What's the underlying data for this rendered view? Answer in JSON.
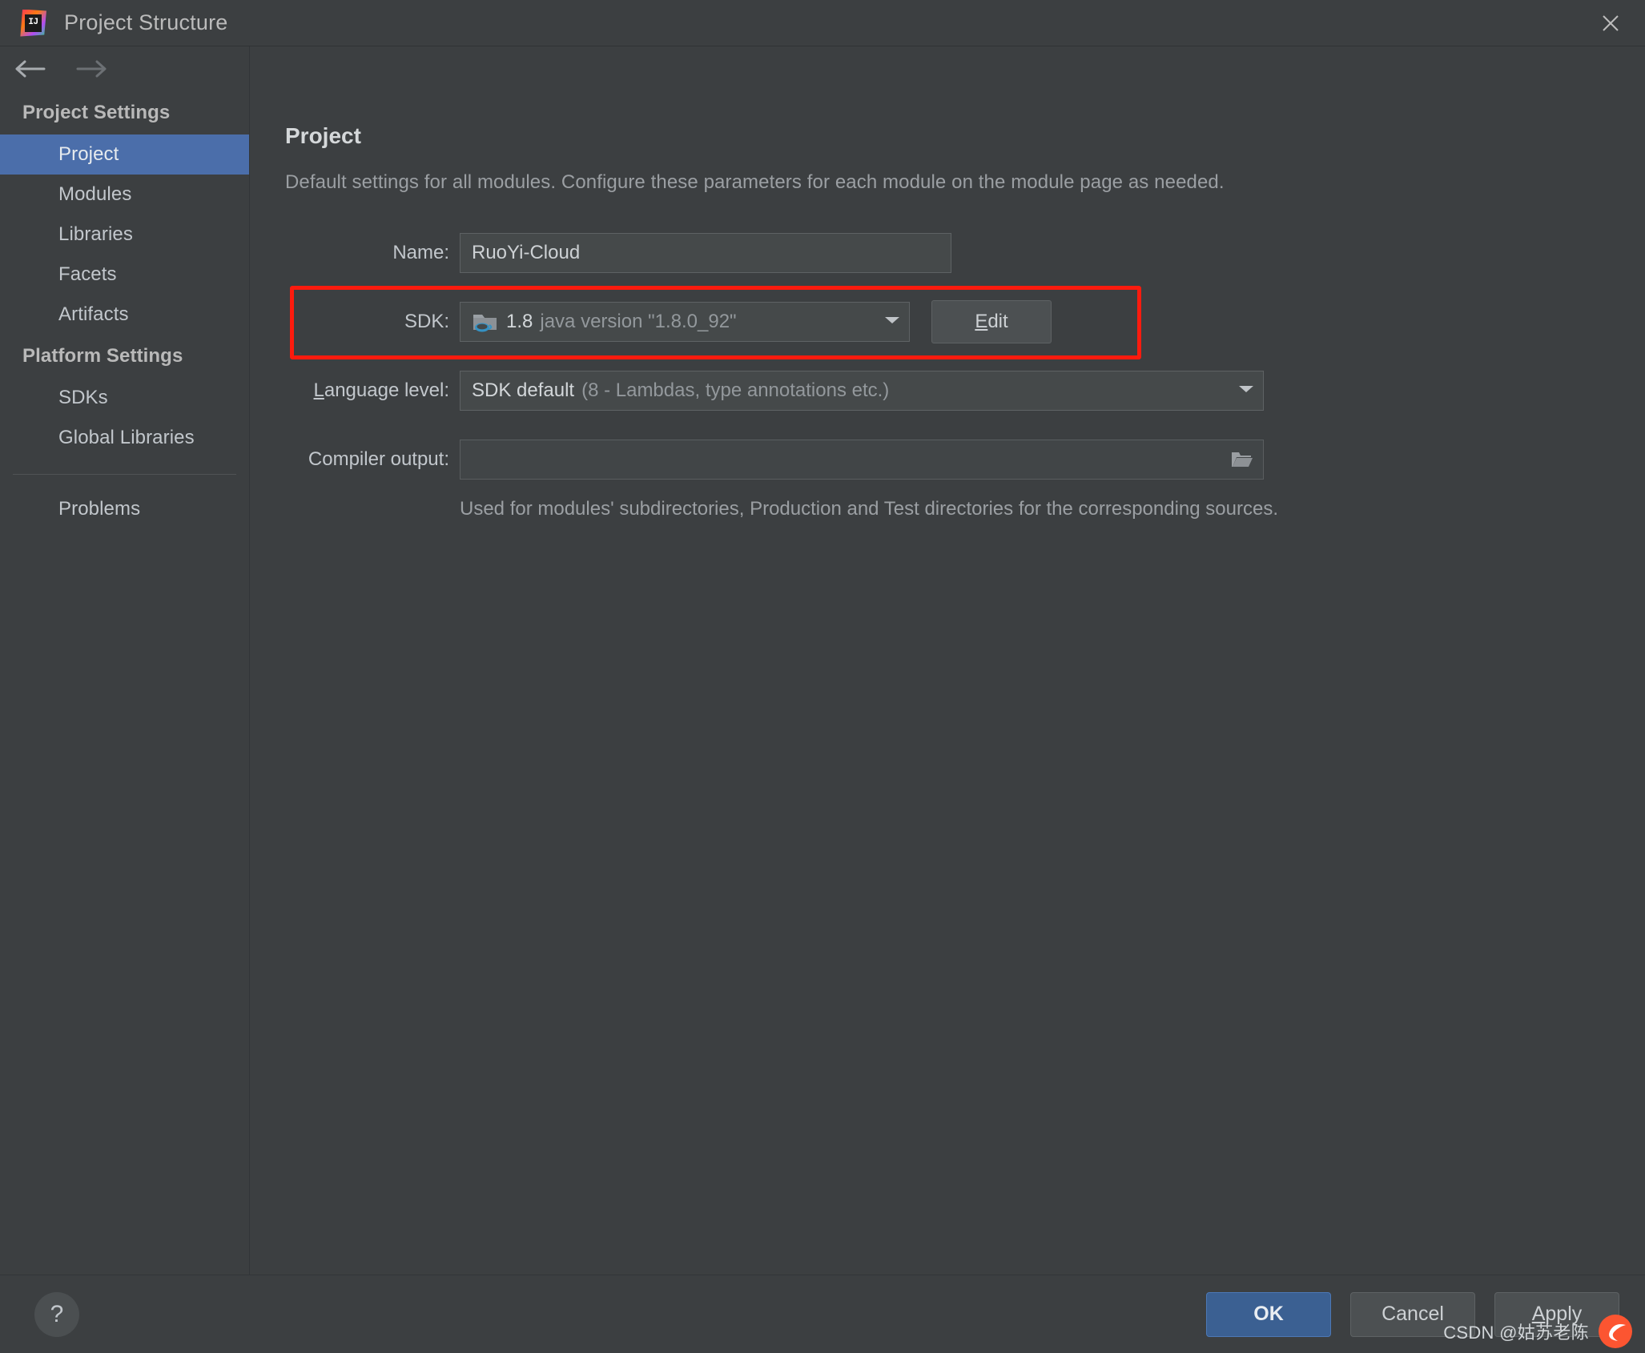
{
  "window": {
    "title": "Project Structure",
    "app_icon": "intellij-idea-icon",
    "close_icon": "close-icon",
    "back_icon": "back-arrow-icon",
    "forward_icon": "forward-arrow-icon"
  },
  "sidebar": {
    "groups": [
      {
        "label": "Project Settings",
        "items": [
          {
            "label": "Project",
            "selected": true
          },
          {
            "label": "Modules",
            "selected": false
          },
          {
            "label": "Libraries",
            "selected": false
          },
          {
            "label": "Facets",
            "selected": false
          },
          {
            "label": "Artifacts",
            "selected": false
          }
        ]
      },
      {
        "label": "Platform Settings",
        "items": [
          {
            "label": "SDKs",
            "selected": false
          },
          {
            "label": "Global Libraries",
            "selected": false
          }
        ]
      }
    ],
    "extra_items": [
      {
        "label": "Problems",
        "selected": false
      }
    ]
  },
  "main": {
    "title": "Project",
    "description": "Default settings for all modules. Configure these parameters for each module on the module page as needed.",
    "name_row": {
      "label": "Name:",
      "value": "RuoYi-Cloud"
    },
    "sdk_row": {
      "label": "SDK:",
      "icon": "jdk-folder-icon",
      "value_main": "1.8",
      "value_sub": "java version \"1.8.0_92\"",
      "caret_icon": "chevron-down-icon",
      "edit_button": "Edit",
      "edit_mnemonic": "E",
      "highlighted": true,
      "highlight_color": "#fc1b0e"
    },
    "language_level_row": {
      "label": "Language level:",
      "label_mnemonic": "L",
      "value_main": "SDK default",
      "value_sub": "(8 - Lambdas, type annotations etc.)",
      "caret_icon": "chevron-down-icon"
    },
    "compiler_output_row": {
      "label": "Compiler output:",
      "value": "",
      "browse_icon": "folder-open-icon",
      "hint": "Used for modules' subdirectories, Production and Test directories for the corresponding sources."
    }
  },
  "footer": {
    "help_icon": "question-mark-icon",
    "buttons": [
      {
        "label": "OK",
        "primary": true,
        "mnemonic": ""
      },
      {
        "label": "Cancel",
        "primary": false,
        "mnemonic": ""
      },
      {
        "label": "Apply",
        "primary": false,
        "mnemonic": "A"
      }
    ]
  },
  "watermark": {
    "text": "CSDN @姑苏老陈",
    "logo_icon": "csdn-logo-icon"
  },
  "colors": {
    "window_bg": "#3c3f41",
    "selection_blue": "#4b6eaa",
    "primary_button": "#3b6092",
    "annotation_red": "#fc1b0e",
    "text_primary": "#c2c7cc",
    "text_muted": "#9b9fa3"
  }
}
